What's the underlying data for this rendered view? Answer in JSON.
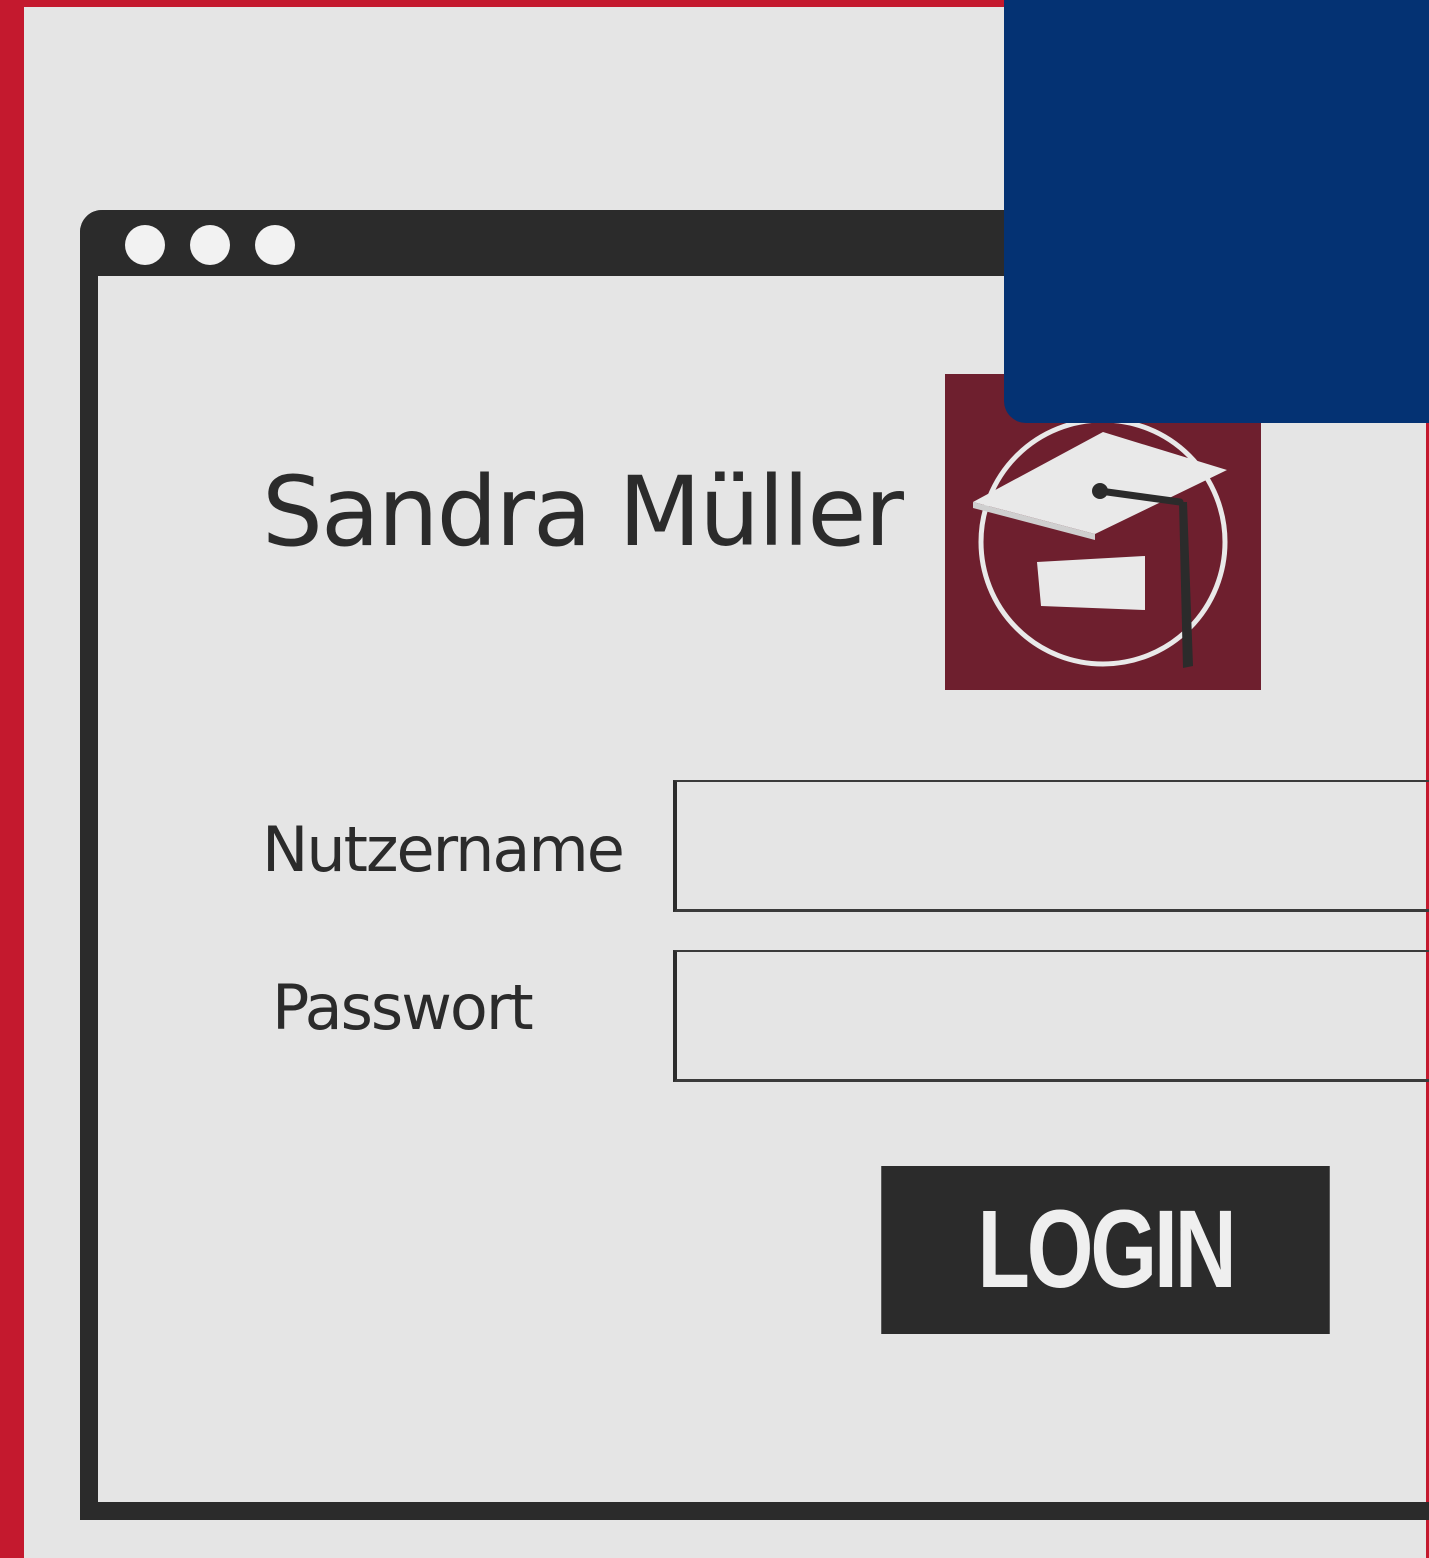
{
  "colors": {
    "frame_red": "#c4192e",
    "panel_blue": "#043273",
    "logo_maroon": "#6e1f2e",
    "window_dark": "#2b2b2b",
    "background_gray": "#e5e5e5"
  },
  "profile": {
    "name": "Sandra Müller",
    "logo_icon": "graduation-cap-icon"
  },
  "form": {
    "username_label": "Nutzername",
    "username_value": "",
    "password_label": "Passwort",
    "password_value": "",
    "login_label": "LOGIN"
  }
}
